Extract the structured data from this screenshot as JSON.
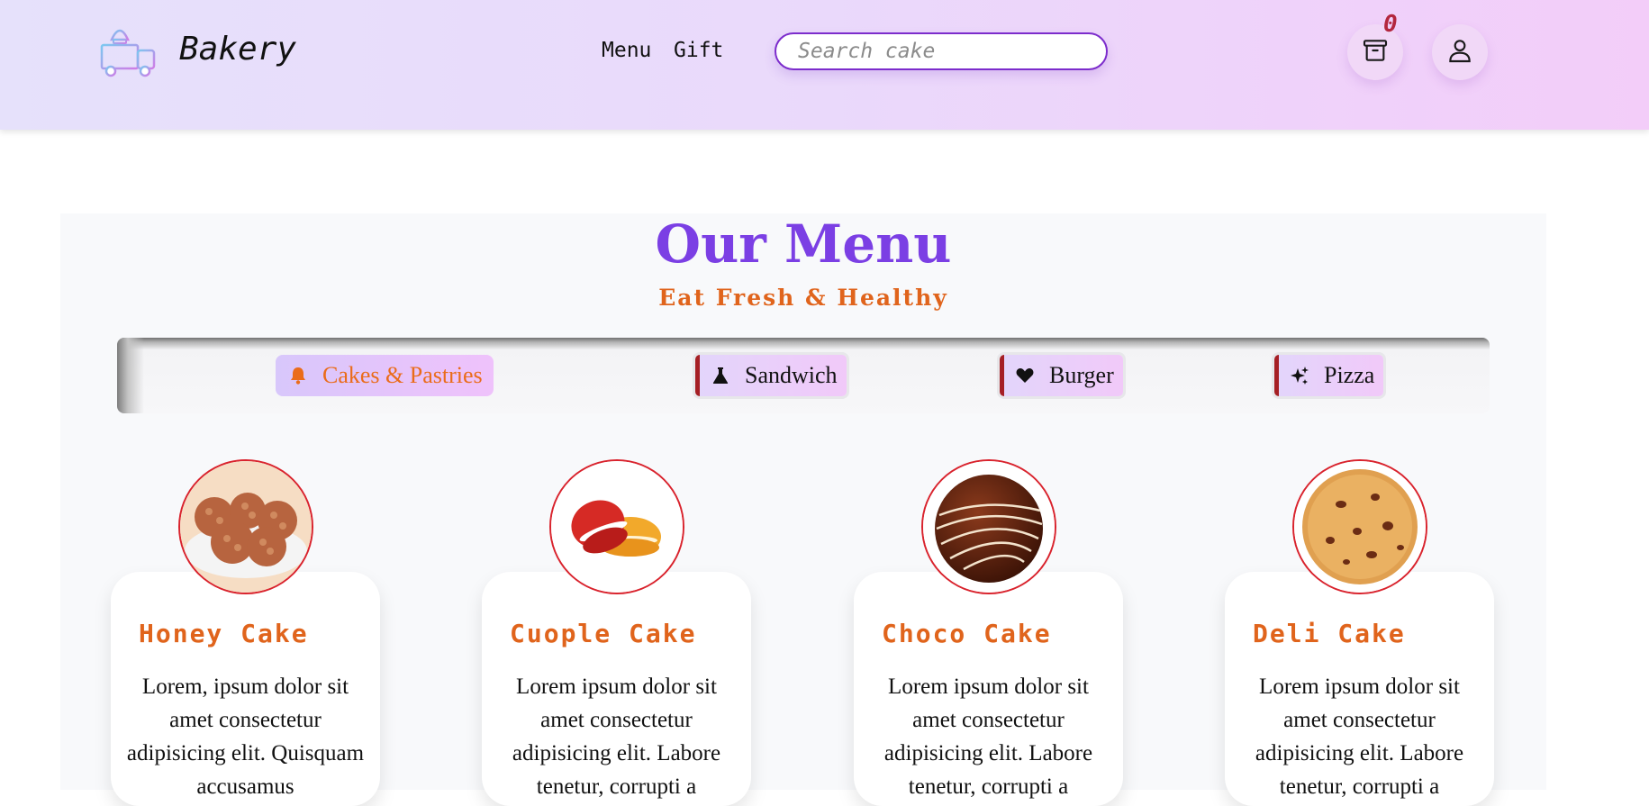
{
  "header": {
    "brand": "Bakery",
    "nav": [
      "Menu",
      "Gift"
    ],
    "search_placeholder": "Search cake",
    "cart_count": "0"
  },
  "menu": {
    "title": "Our Menu",
    "subtitle": "Eat Fresh & Healthy",
    "tabs": [
      {
        "label": "Cakes & Pastries",
        "icon": "bell-icon",
        "active": true
      },
      {
        "label": "Sandwich",
        "icon": "flask-icon",
        "active": false
      },
      {
        "label": "Burger",
        "icon": "heart-icon",
        "active": false
      },
      {
        "label": "Pizza",
        "icon": "sparkles-icon",
        "active": false
      }
    ],
    "cards": [
      {
        "name": "Honey Cake",
        "description": "Lorem, ipsum dolor sit amet consectetur adipisicing elit. Quisquam accusamus",
        "image": "honey-cake-image"
      },
      {
        "name": "Cuople Cake",
        "description": "Lorem ipsum dolor sit amet consectetur adipisicing elit. Labore tenetur, corrupti a",
        "image": "macaron-image"
      },
      {
        "name": "Choco Cake",
        "description": "Lorem ipsum dolor sit amet consectetur adipisicing elit. Labore tenetur, corrupti a",
        "image": "chocolate-truffle-image"
      },
      {
        "name": "Deli Cake",
        "description": "Lorem ipsum dolor sit amet consectetur adipisicing elit. Labore tenetur, corrupti a",
        "image": "cookie-image"
      }
    ]
  },
  "colors": {
    "brand_purple": "#7b3fe4",
    "accent_orange": "#e0641c",
    "card_border_red": "#d9232d",
    "cart_badge": "#b3263e"
  }
}
